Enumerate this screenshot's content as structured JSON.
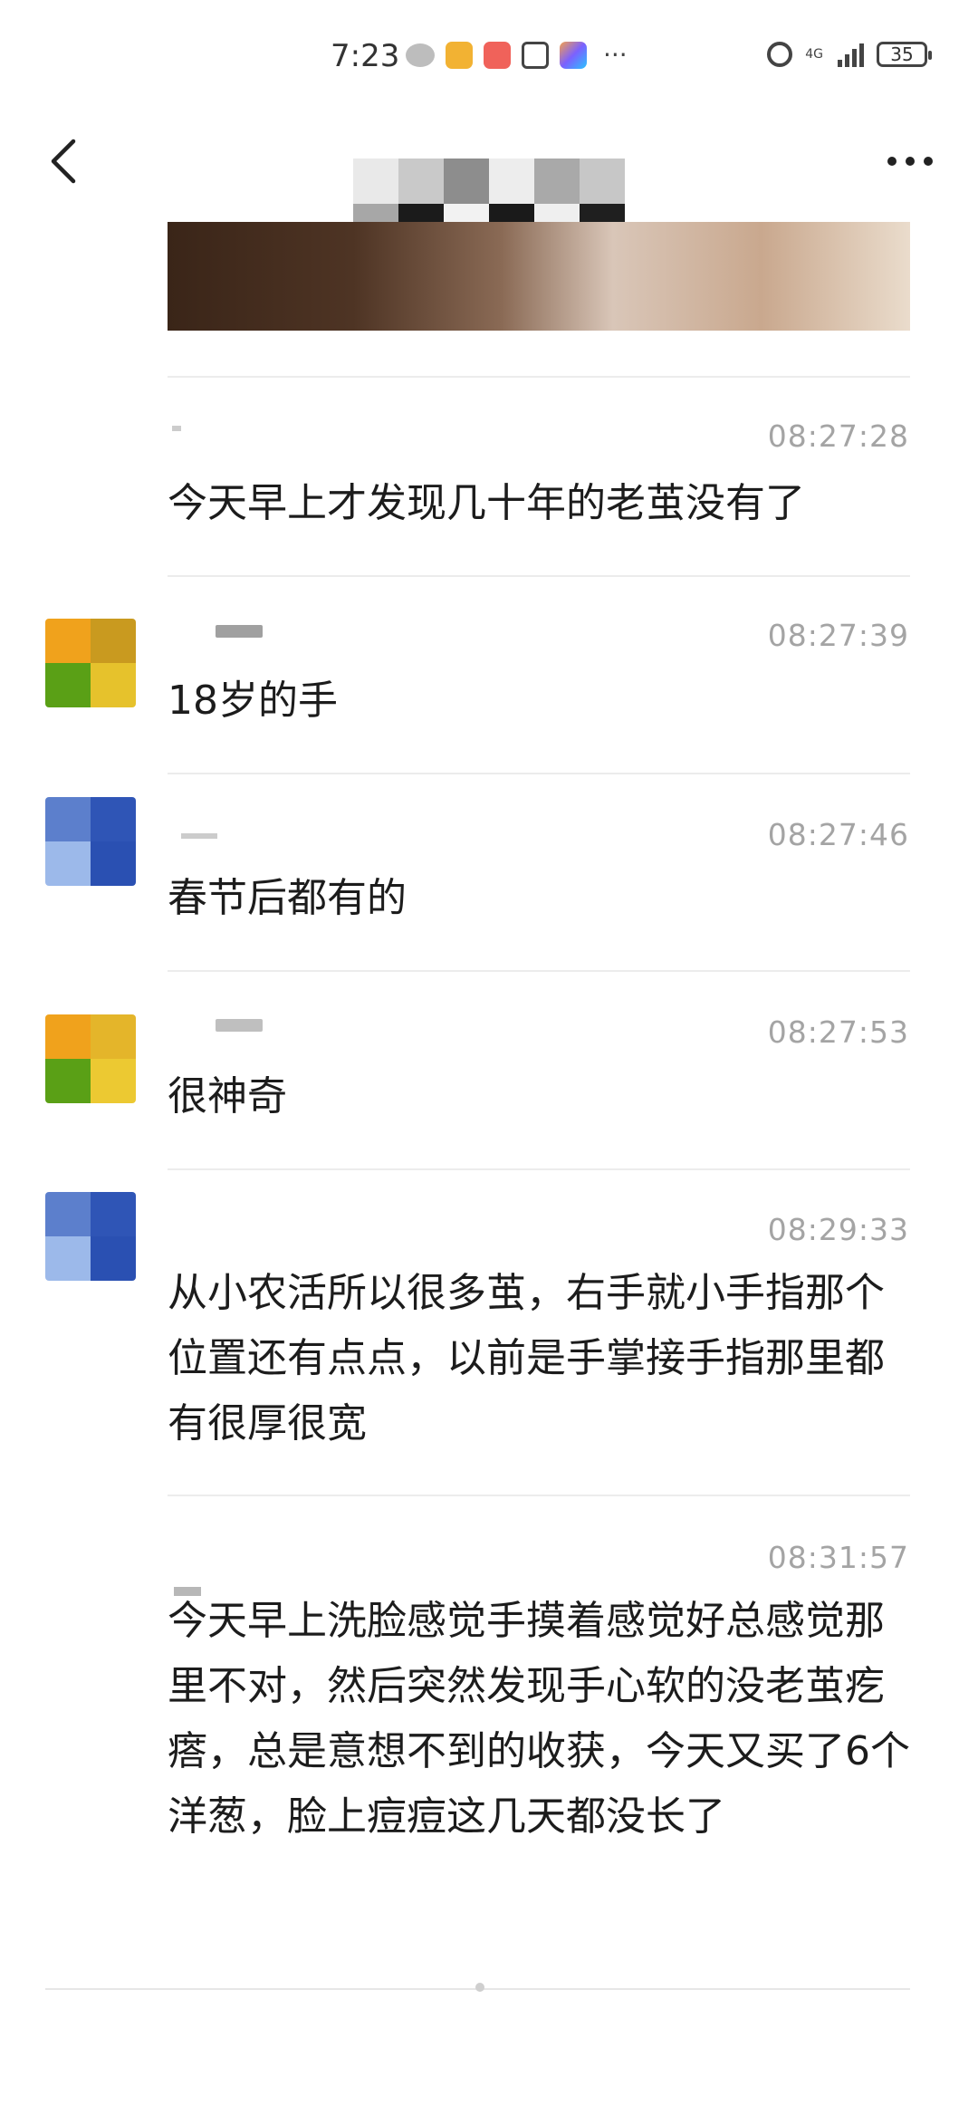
{
  "status_bar": {
    "time": "7:23",
    "network": "4G",
    "battery": "35",
    "more": "···"
  },
  "messages": [
    {
      "time": "08:27:28",
      "text": "今天早上才发现几十年的老茧没有了"
    },
    {
      "time": "08:27:39",
      "text": "18岁的手"
    },
    {
      "time": "08:27:46",
      "text": "春节后都有的"
    },
    {
      "time": "08:27:53",
      "text": "很神奇"
    },
    {
      "time": "08:29:33",
      "text": "从小农活所以很多茧，右手就小手指那个位置还有点点，以前是手掌接手指那里都有很厚很宽"
    },
    {
      "time": "08:31:57",
      "text": "今天早上洗脸感觉手摸着感觉好总感觉那里不对，然后突然发现手心软的没老茧疙瘩，总是意想不到的收获，今天又买了6个洋葱，脸上痘痘这几天都没长了"
    }
  ],
  "colors": {
    "timestamp": "#a4a4a4",
    "divider": "#ececec",
    "text": "#1c1c1c"
  },
  "icons": {
    "back": "chevron-left-icon",
    "more": "more-dots-icon"
  }
}
